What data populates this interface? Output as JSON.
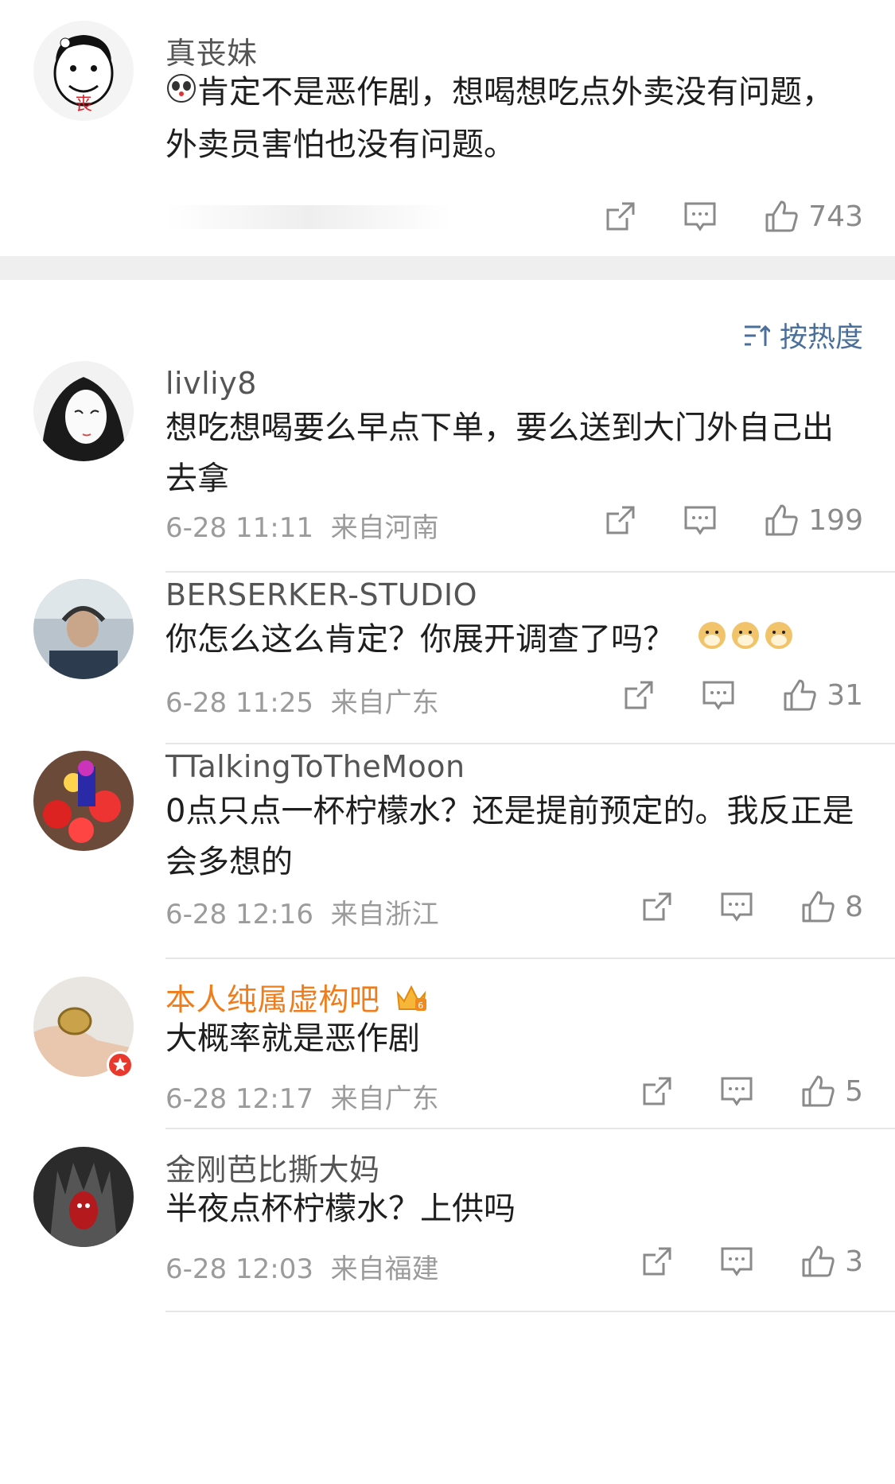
{
  "top_comment": {
    "name": "真丧妹",
    "text": "肯定不是恶作剧，想喝想吃点外卖没有问题，外卖员害怕也没有问题。",
    "likes": "743"
  },
  "sort": {
    "label": "按热度",
    "icon": "sort-icon"
  },
  "comments": [
    {
      "name": "livliy8",
      "text": "想吃想喝要么早点下单，要么送到大门外自己出去拿",
      "date": "6-28 11:11",
      "location": "来自河南",
      "likes": "199",
      "vip": false
    },
    {
      "name": "BERSERKER-STUDIO",
      "text": "你怎么这么肯定？你展开调查了吗？",
      "date": "6-28 11:25",
      "location": "来自广东",
      "likes": "31",
      "vip": false
    },
    {
      "name": "TTalkingToTheMoon",
      "text": "0点只点一杯柠檬水？还是提前预定的。我反正是会多想的",
      "date": "6-28 12:16",
      "location": "来自浙江",
      "likes": "8",
      "vip": false
    },
    {
      "name": "本人纯属虚构吧",
      "text": "大概率就是恶作剧",
      "date": "6-28 12:17",
      "location": "来自广东",
      "likes": "5",
      "vip": true
    },
    {
      "name": "金刚芭比撕大妈",
      "text": "半夜点杯柠檬水？上供吗",
      "date": "6-28 12:03",
      "location": "来自福建",
      "likes": "3",
      "vip": false
    }
  ],
  "colors": {
    "link": "#4a6f9b",
    "vip": "#f07d1b",
    "gray": "#9b9b9b",
    "band": "#efefef"
  }
}
